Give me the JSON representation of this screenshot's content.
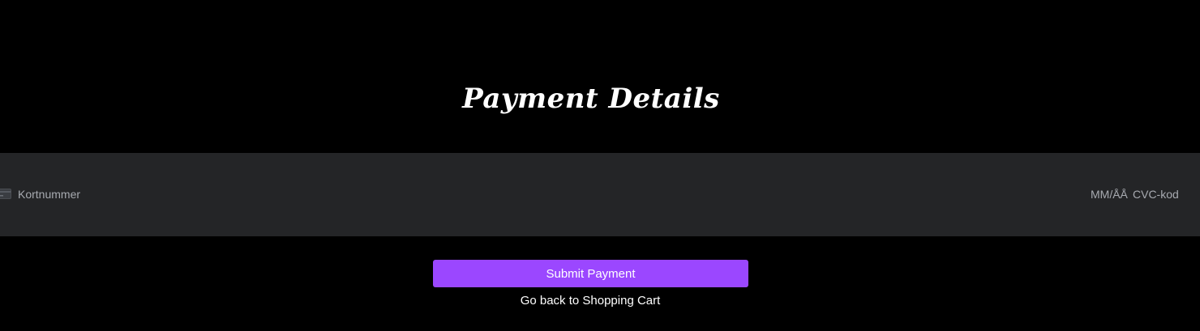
{
  "page": {
    "title": "Payment Details"
  },
  "card_form": {
    "card_icon": "credit-card-icon",
    "card_number_placeholder": "Kortnummer",
    "expiry_placeholder": "MM/ÅÅ",
    "cvc_placeholder": "CVC-kod"
  },
  "actions": {
    "submit_label": "Submit Payment",
    "back_label": "Go back to Shopping Cart"
  },
  "colors": {
    "background": "#000000",
    "panel": "#242527",
    "accent": "#9b47ff",
    "placeholder_text": "#a7aab0"
  }
}
